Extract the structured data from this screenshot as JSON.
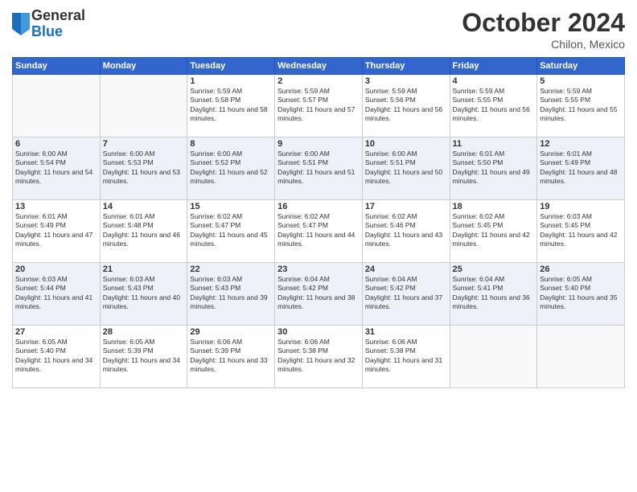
{
  "header": {
    "logo_general": "General",
    "logo_blue": "Blue",
    "month": "October 2024",
    "location": "Chilon, Mexico"
  },
  "days_header": [
    "Sunday",
    "Monday",
    "Tuesday",
    "Wednesday",
    "Thursday",
    "Friday",
    "Saturday"
  ],
  "weeks": [
    [
      {
        "day": "",
        "info": ""
      },
      {
        "day": "",
        "info": ""
      },
      {
        "day": "1",
        "info": "Sunrise: 5:59 AM\nSunset: 5:58 PM\nDaylight: 11 hours and 58 minutes."
      },
      {
        "day": "2",
        "info": "Sunrise: 5:59 AM\nSunset: 5:57 PM\nDaylight: 11 hours and 57 minutes."
      },
      {
        "day": "3",
        "info": "Sunrise: 5:59 AM\nSunset: 5:56 PM\nDaylight: 11 hours and 56 minutes."
      },
      {
        "day": "4",
        "info": "Sunrise: 5:59 AM\nSunset: 5:55 PM\nDaylight: 11 hours and 56 minutes."
      },
      {
        "day": "5",
        "info": "Sunrise: 5:59 AM\nSunset: 5:55 PM\nDaylight: 11 hours and 55 minutes."
      }
    ],
    [
      {
        "day": "6",
        "info": "Sunrise: 6:00 AM\nSunset: 5:54 PM\nDaylight: 11 hours and 54 minutes."
      },
      {
        "day": "7",
        "info": "Sunrise: 6:00 AM\nSunset: 5:53 PM\nDaylight: 11 hours and 53 minutes."
      },
      {
        "day": "8",
        "info": "Sunrise: 6:00 AM\nSunset: 5:52 PM\nDaylight: 11 hours and 52 minutes."
      },
      {
        "day": "9",
        "info": "Sunrise: 6:00 AM\nSunset: 5:51 PM\nDaylight: 11 hours and 51 minutes."
      },
      {
        "day": "10",
        "info": "Sunrise: 6:00 AM\nSunset: 5:51 PM\nDaylight: 11 hours and 50 minutes."
      },
      {
        "day": "11",
        "info": "Sunrise: 6:01 AM\nSunset: 5:50 PM\nDaylight: 11 hours and 49 minutes."
      },
      {
        "day": "12",
        "info": "Sunrise: 6:01 AM\nSunset: 5:49 PM\nDaylight: 11 hours and 48 minutes."
      }
    ],
    [
      {
        "day": "13",
        "info": "Sunrise: 6:01 AM\nSunset: 5:49 PM\nDaylight: 11 hours and 47 minutes."
      },
      {
        "day": "14",
        "info": "Sunrise: 6:01 AM\nSunset: 5:48 PM\nDaylight: 11 hours and 46 minutes."
      },
      {
        "day": "15",
        "info": "Sunrise: 6:02 AM\nSunset: 5:47 PM\nDaylight: 11 hours and 45 minutes."
      },
      {
        "day": "16",
        "info": "Sunrise: 6:02 AM\nSunset: 5:47 PM\nDaylight: 11 hours and 44 minutes."
      },
      {
        "day": "17",
        "info": "Sunrise: 6:02 AM\nSunset: 5:46 PM\nDaylight: 11 hours and 43 minutes."
      },
      {
        "day": "18",
        "info": "Sunrise: 6:02 AM\nSunset: 5:45 PM\nDaylight: 11 hours and 42 minutes."
      },
      {
        "day": "19",
        "info": "Sunrise: 6:03 AM\nSunset: 5:45 PM\nDaylight: 11 hours and 42 minutes."
      }
    ],
    [
      {
        "day": "20",
        "info": "Sunrise: 6:03 AM\nSunset: 5:44 PM\nDaylight: 11 hours and 41 minutes."
      },
      {
        "day": "21",
        "info": "Sunrise: 6:03 AM\nSunset: 5:43 PM\nDaylight: 11 hours and 40 minutes."
      },
      {
        "day": "22",
        "info": "Sunrise: 6:03 AM\nSunset: 5:43 PM\nDaylight: 11 hours and 39 minutes."
      },
      {
        "day": "23",
        "info": "Sunrise: 6:04 AM\nSunset: 5:42 PM\nDaylight: 11 hours and 38 minutes."
      },
      {
        "day": "24",
        "info": "Sunrise: 6:04 AM\nSunset: 5:42 PM\nDaylight: 11 hours and 37 minutes."
      },
      {
        "day": "25",
        "info": "Sunrise: 6:04 AM\nSunset: 5:41 PM\nDaylight: 11 hours and 36 minutes."
      },
      {
        "day": "26",
        "info": "Sunrise: 6:05 AM\nSunset: 5:40 PM\nDaylight: 11 hours and 35 minutes."
      }
    ],
    [
      {
        "day": "27",
        "info": "Sunrise: 6:05 AM\nSunset: 5:40 PM\nDaylight: 11 hours and 34 minutes."
      },
      {
        "day": "28",
        "info": "Sunrise: 6:05 AM\nSunset: 5:39 PM\nDaylight: 11 hours and 34 minutes."
      },
      {
        "day": "29",
        "info": "Sunrise: 6:06 AM\nSunset: 5:39 PM\nDaylight: 11 hours and 33 minutes."
      },
      {
        "day": "30",
        "info": "Sunrise: 6:06 AM\nSunset: 5:38 PM\nDaylight: 11 hours and 32 minutes."
      },
      {
        "day": "31",
        "info": "Sunrise: 6:06 AM\nSunset: 5:38 PM\nDaylight: 11 hours and 31 minutes."
      },
      {
        "day": "",
        "info": ""
      },
      {
        "day": "",
        "info": ""
      }
    ]
  ]
}
